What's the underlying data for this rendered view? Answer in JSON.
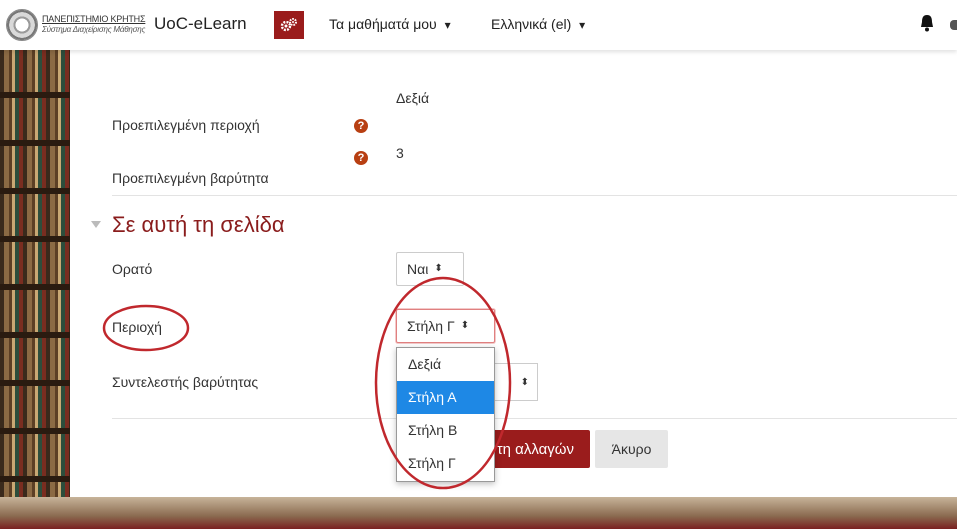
{
  "header": {
    "logo_line1": "ΠΑΝΕΠΙΣΤΗΜΙΟ ΚΡΗΤΗΣ",
    "logo_line2": "Σύστημα Διαχείρισης Μάθησης",
    "site_name": "UoC-eLearn",
    "my_courses": "Τα μαθήματά μου",
    "language": "Ελληνικά (el)"
  },
  "defaults": {
    "region_label": "Προεπιλεγμένη περιοχή",
    "region_value": "Δεξιά",
    "weight_label": "Προεπιλεγμένη βαρύτητα",
    "weight_value": "3"
  },
  "section": {
    "title": "Σε αυτή τη σελίδα",
    "visible_label": "Ορατό",
    "visible_value": "Ναι",
    "region_label": "Περιοχή",
    "region_value": "Στήλη Γ",
    "weight_label": "Συντελεστής βαρύτητας"
  },
  "dropdown": {
    "options": [
      "Δεξιά",
      "Στήλη Α",
      "Στήλη Β",
      "Στήλη Γ"
    ],
    "selected_index": 1
  },
  "buttons": {
    "save_partial": "τη αλλαγών",
    "cancel": "Άκυρο"
  },
  "colors": {
    "accent": "#9a1c1c",
    "help_icon": "#b83f12",
    "selected_option": "#1e88e5",
    "annotation": "#c0282d"
  },
  "icons": {
    "help": "?",
    "caret": "▾",
    "updown": "⬍"
  }
}
